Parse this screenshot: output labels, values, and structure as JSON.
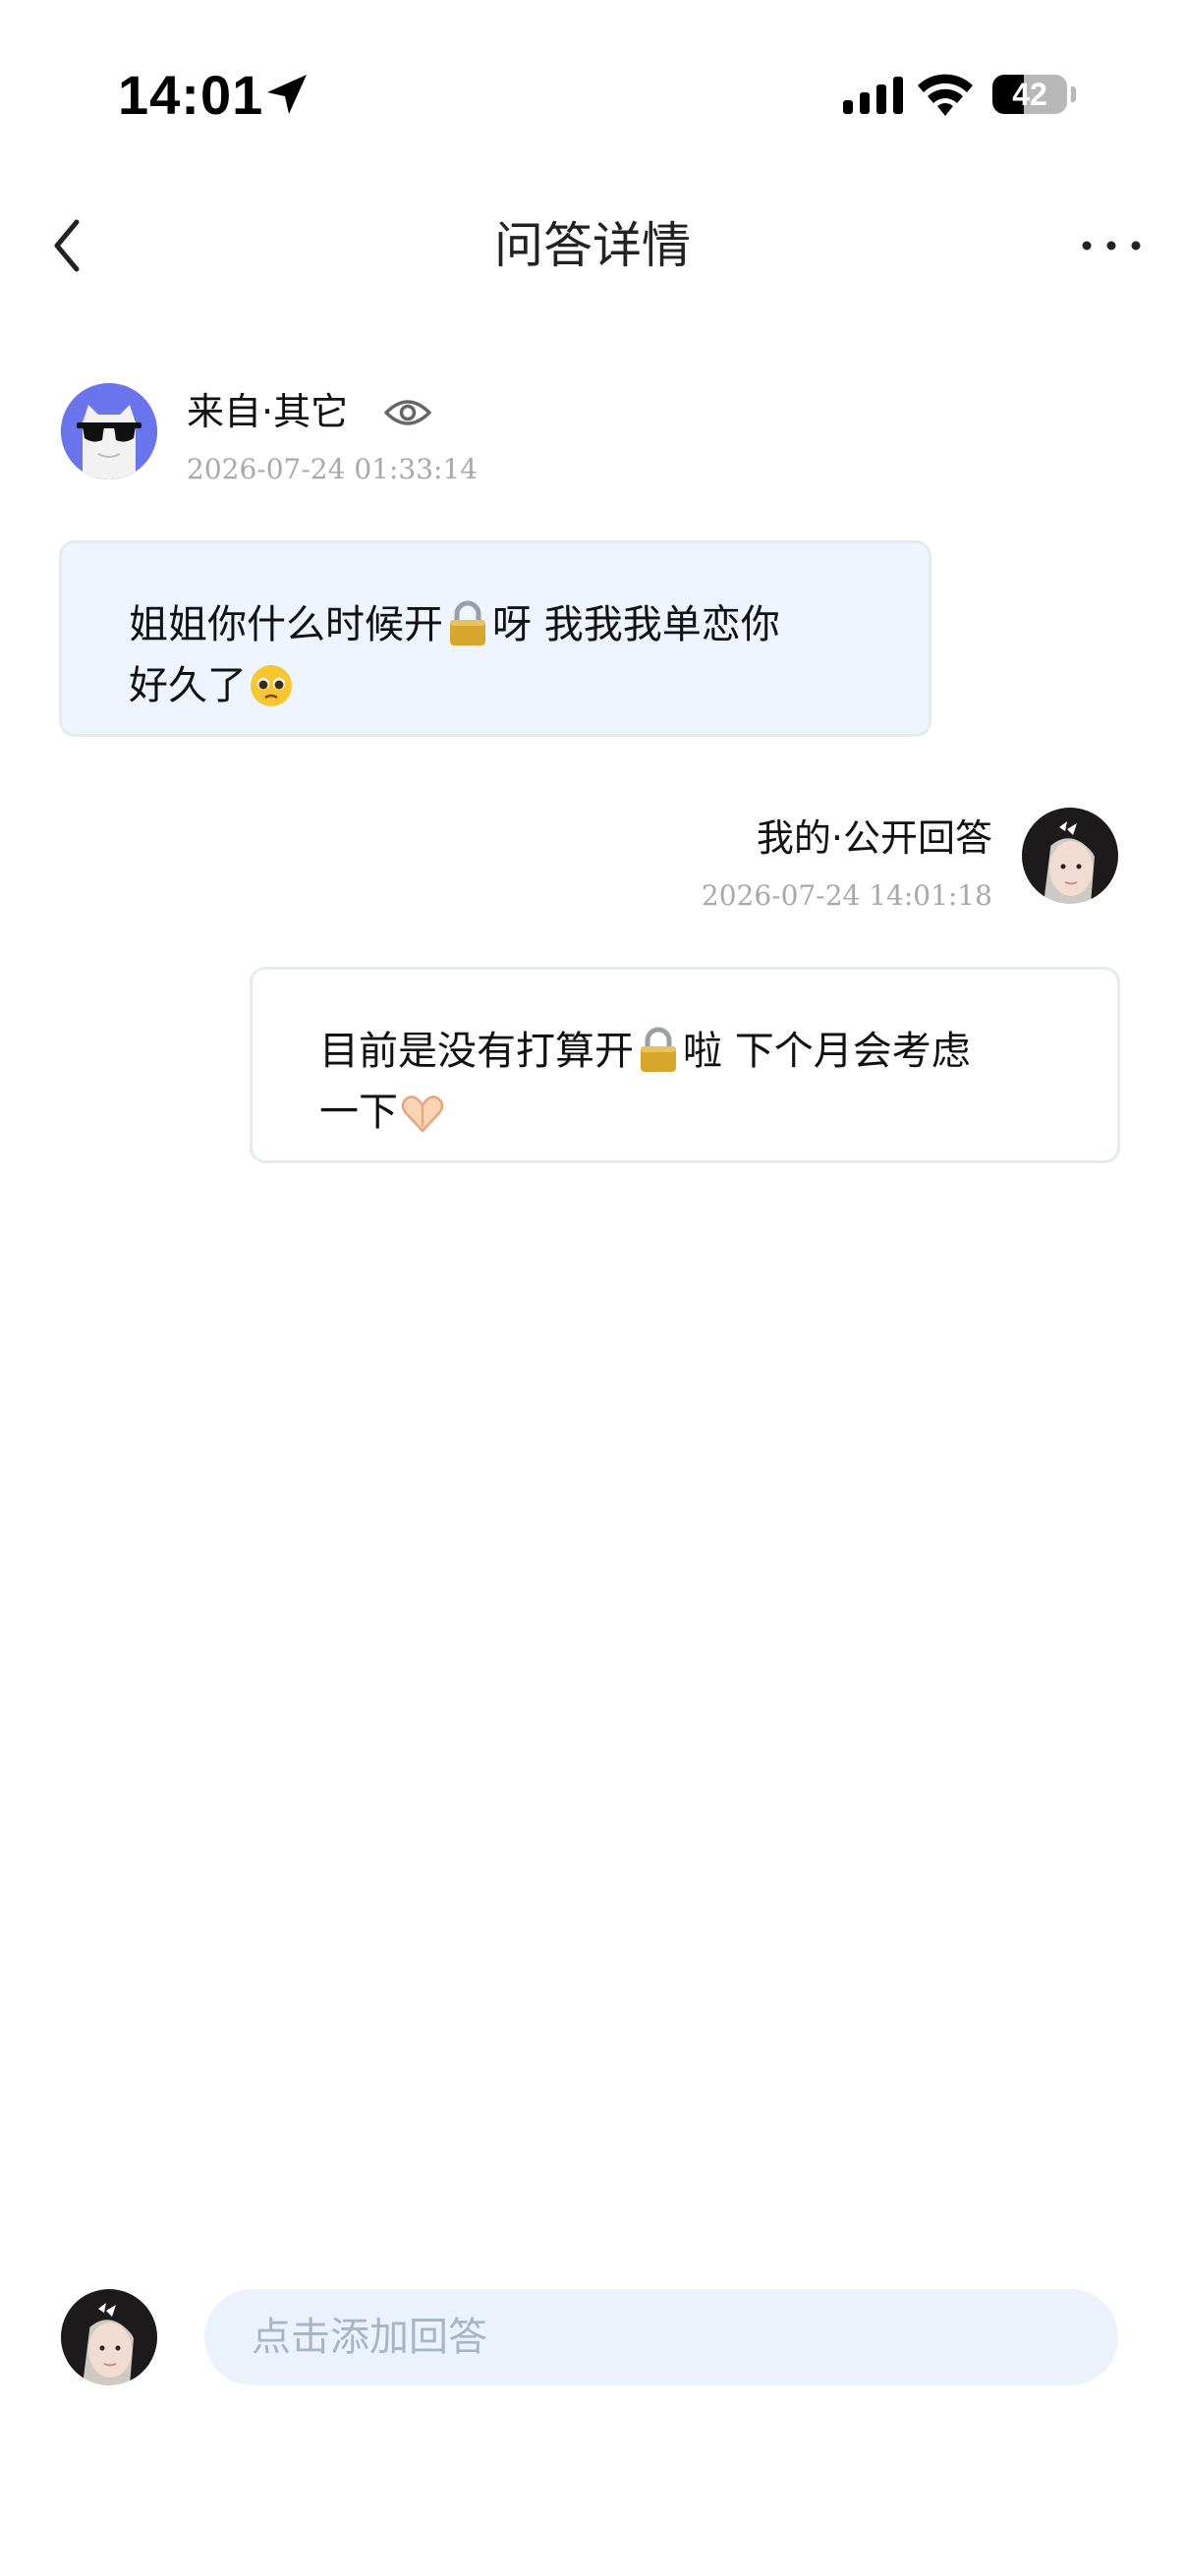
{
  "status_bar": {
    "time": "14:01",
    "battery_level": "42",
    "battery_fraction": 0.42,
    "icons": [
      "location-arrow-icon",
      "cellular-signal-icon",
      "wifi-icon",
      "battery-icon"
    ]
  },
  "nav": {
    "title": "问答详情",
    "back_icon": "chevron-left-icon",
    "more_icon": "more-dots-icon"
  },
  "question": {
    "source_label": "来自·其它",
    "visibility_icon": "eye-icon",
    "timestamp": "2026-07-24 01:33:14",
    "avatar_icon": "cat-sunglasses-avatar",
    "text_line1_part1": "姐姐你什么时候开",
    "text_line1_part2": "呀 我我我单恋你",
    "text_line2_part1": "好久了"
  },
  "answer": {
    "label": "我的·公开回答",
    "timestamp": "2026-07-24 14:01:18",
    "text_line1_part1": "目前是没有打算开",
    "text_line1_part2": "啦 下个月会考虑",
    "text_line2_part1": "一下"
  },
  "reply_bar": {
    "placeholder": "点击添加回答"
  },
  "colors": {
    "question_bubble_bg": "#eef5fe",
    "bubble_border": "#e6ebf0",
    "input_bg": "#ecf2fc",
    "timestamp_gray": "#a9a9a9",
    "asker_avatar_bg": "#6a74ec"
  }
}
